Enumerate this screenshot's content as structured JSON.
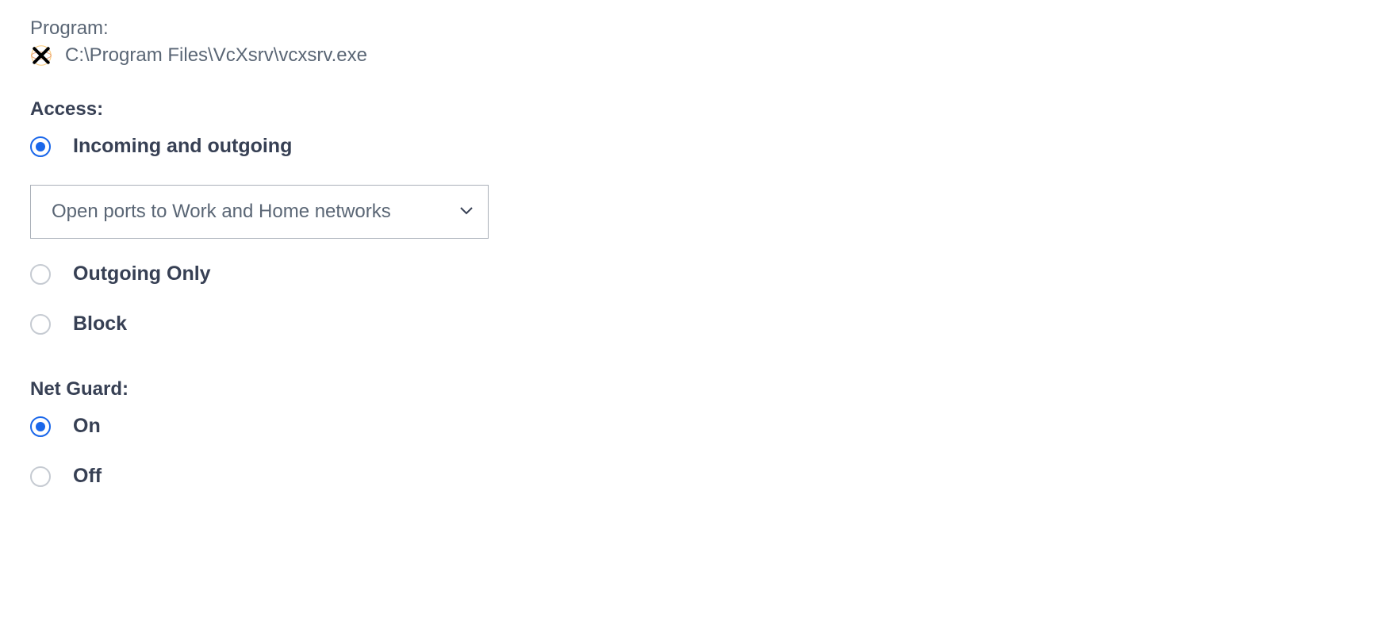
{
  "program": {
    "label": "Program:",
    "path": "C:\\Program Files\\VcXsrv\\vcxsrv.exe",
    "icon_name": "vcxsrv-x-icon"
  },
  "access": {
    "label": "Access:",
    "options": {
      "incoming_outgoing": "Incoming and outgoing",
      "outgoing_only": "Outgoing Only",
      "block": "Block"
    },
    "selected": "incoming_outgoing",
    "ports_select": {
      "selected_label": "Open ports to Work and Home networks"
    }
  },
  "net_guard": {
    "label": "Net Guard:",
    "options": {
      "on": "On",
      "off": "Off"
    },
    "selected": "on"
  }
}
